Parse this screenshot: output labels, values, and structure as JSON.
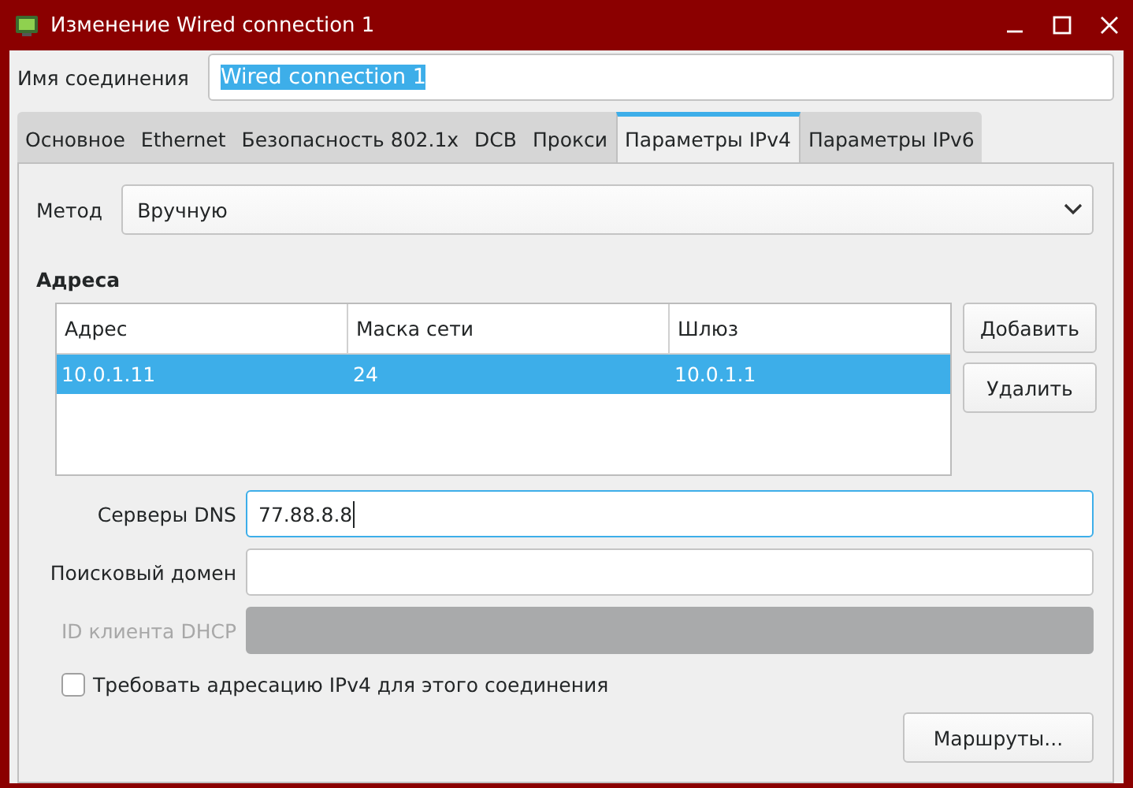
{
  "window": {
    "title": "Изменение Wired connection 1"
  },
  "connection_name": {
    "label": "Имя соединения",
    "value": "Wired connection 1",
    "text_selected": true
  },
  "tabs": [
    {
      "label": "Основное",
      "selected": false
    },
    {
      "label": "Ethernet",
      "selected": false
    },
    {
      "label": "Безопасность 802.1x",
      "selected": false
    },
    {
      "label": "DCB",
      "selected": false
    },
    {
      "label": "Прокси",
      "selected": false
    },
    {
      "label": "Параметры IPv4",
      "selected": true
    },
    {
      "label": "Параметры IPv6",
      "selected": false
    }
  ],
  "method": {
    "label": "Метод",
    "value": "Вручную"
  },
  "addresses": {
    "title": "Адреса",
    "columns": [
      "Адрес",
      "Маска сети",
      "Шлюз"
    ],
    "rows": [
      {
        "cells": [
          "10.0.1.11",
          "24",
          "10.0.1.1"
        ],
        "selected": true
      }
    ],
    "buttons": [
      "Добавить",
      "Удалить"
    ]
  },
  "fields": [
    {
      "label": "Серверы DNS",
      "value": "77.88.8.8",
      "focused": true,
      "disabled": false
    },
    {
      "label": "Поисковый домен",
      "focused": false,
      "disabled": false
    },
    {
      "label": "ID клиента DHCP",
      "focused": false,
      "disabled": true
    }
  ],
  "require_ipv4": {
    "label": "Требовать адресацию IPv4 для этого соединения",
    "checked": false
  },
  "routes_button": "Маршруты..."
}
